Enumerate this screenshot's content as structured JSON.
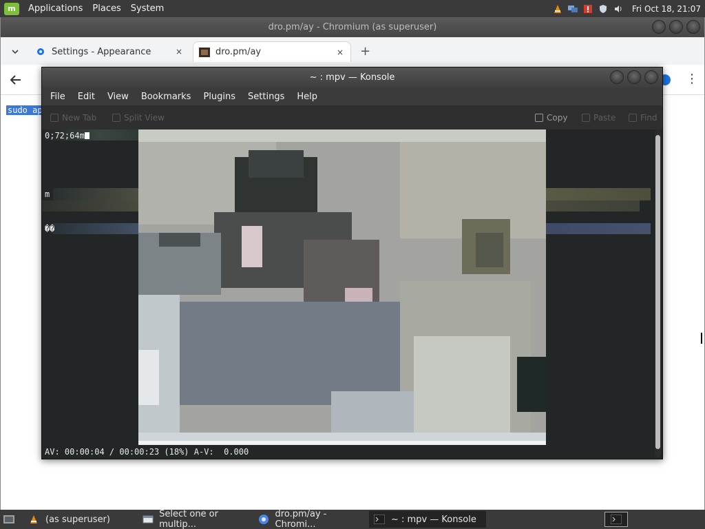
{
  "top_panel": {
    "menu": [
      "Applications",
      "Places",
      "System"
    ],
    "clock": "Fri Oct 18, 21:07"
  },
  "chromium": {
    "title": "dro.pm/ay - Chromium (as superuser)",
    "tabs": [
      {
        "label": "Settings - Appearance",
        "close": "×"
      },
      {
        "label": "dro.pm/ay",
        "close": "×"
      }
    ],
    "new_tab": "+",
    "page_text": "sudo ap"
  },
  "konsole": {
    "title": "~ : mpv — Konsole",
    "menu": [
      "File",
      "Edit",
      "View",
      "Bookmarks",
      "Plugins",
      "Settings",
      "Help"
    ],
    "toolbar": {
      "new_tab": "New Tab",
      "split_view": "Split View",
      "copy": "Copy",
      "paste": "Paste",
      "find": "Find"
    },
    "terminal_lines": [
      "0;72;64m",
      "m",
      "��"
    ],
    "status": "AV: 00:00:04 / 00:00:23 (18%) A-V:  0.000"
  },
  "taskbar": {
    "tasks": [
      {
        "label": "(as superuser)",
        "icon": "vlc-icon"
      },
      {
        "label": "Select one or multip...",
        "icon": "file-dialog-icon"
      },
      {
        "label": "dro.pm/ay - Chromi...",
        "icon": "chromium-icon"
      },
      {
        "label": "~ : mpv — Konsole",
        "icon": "terminal-icon"
      }
    ]
  }
}
